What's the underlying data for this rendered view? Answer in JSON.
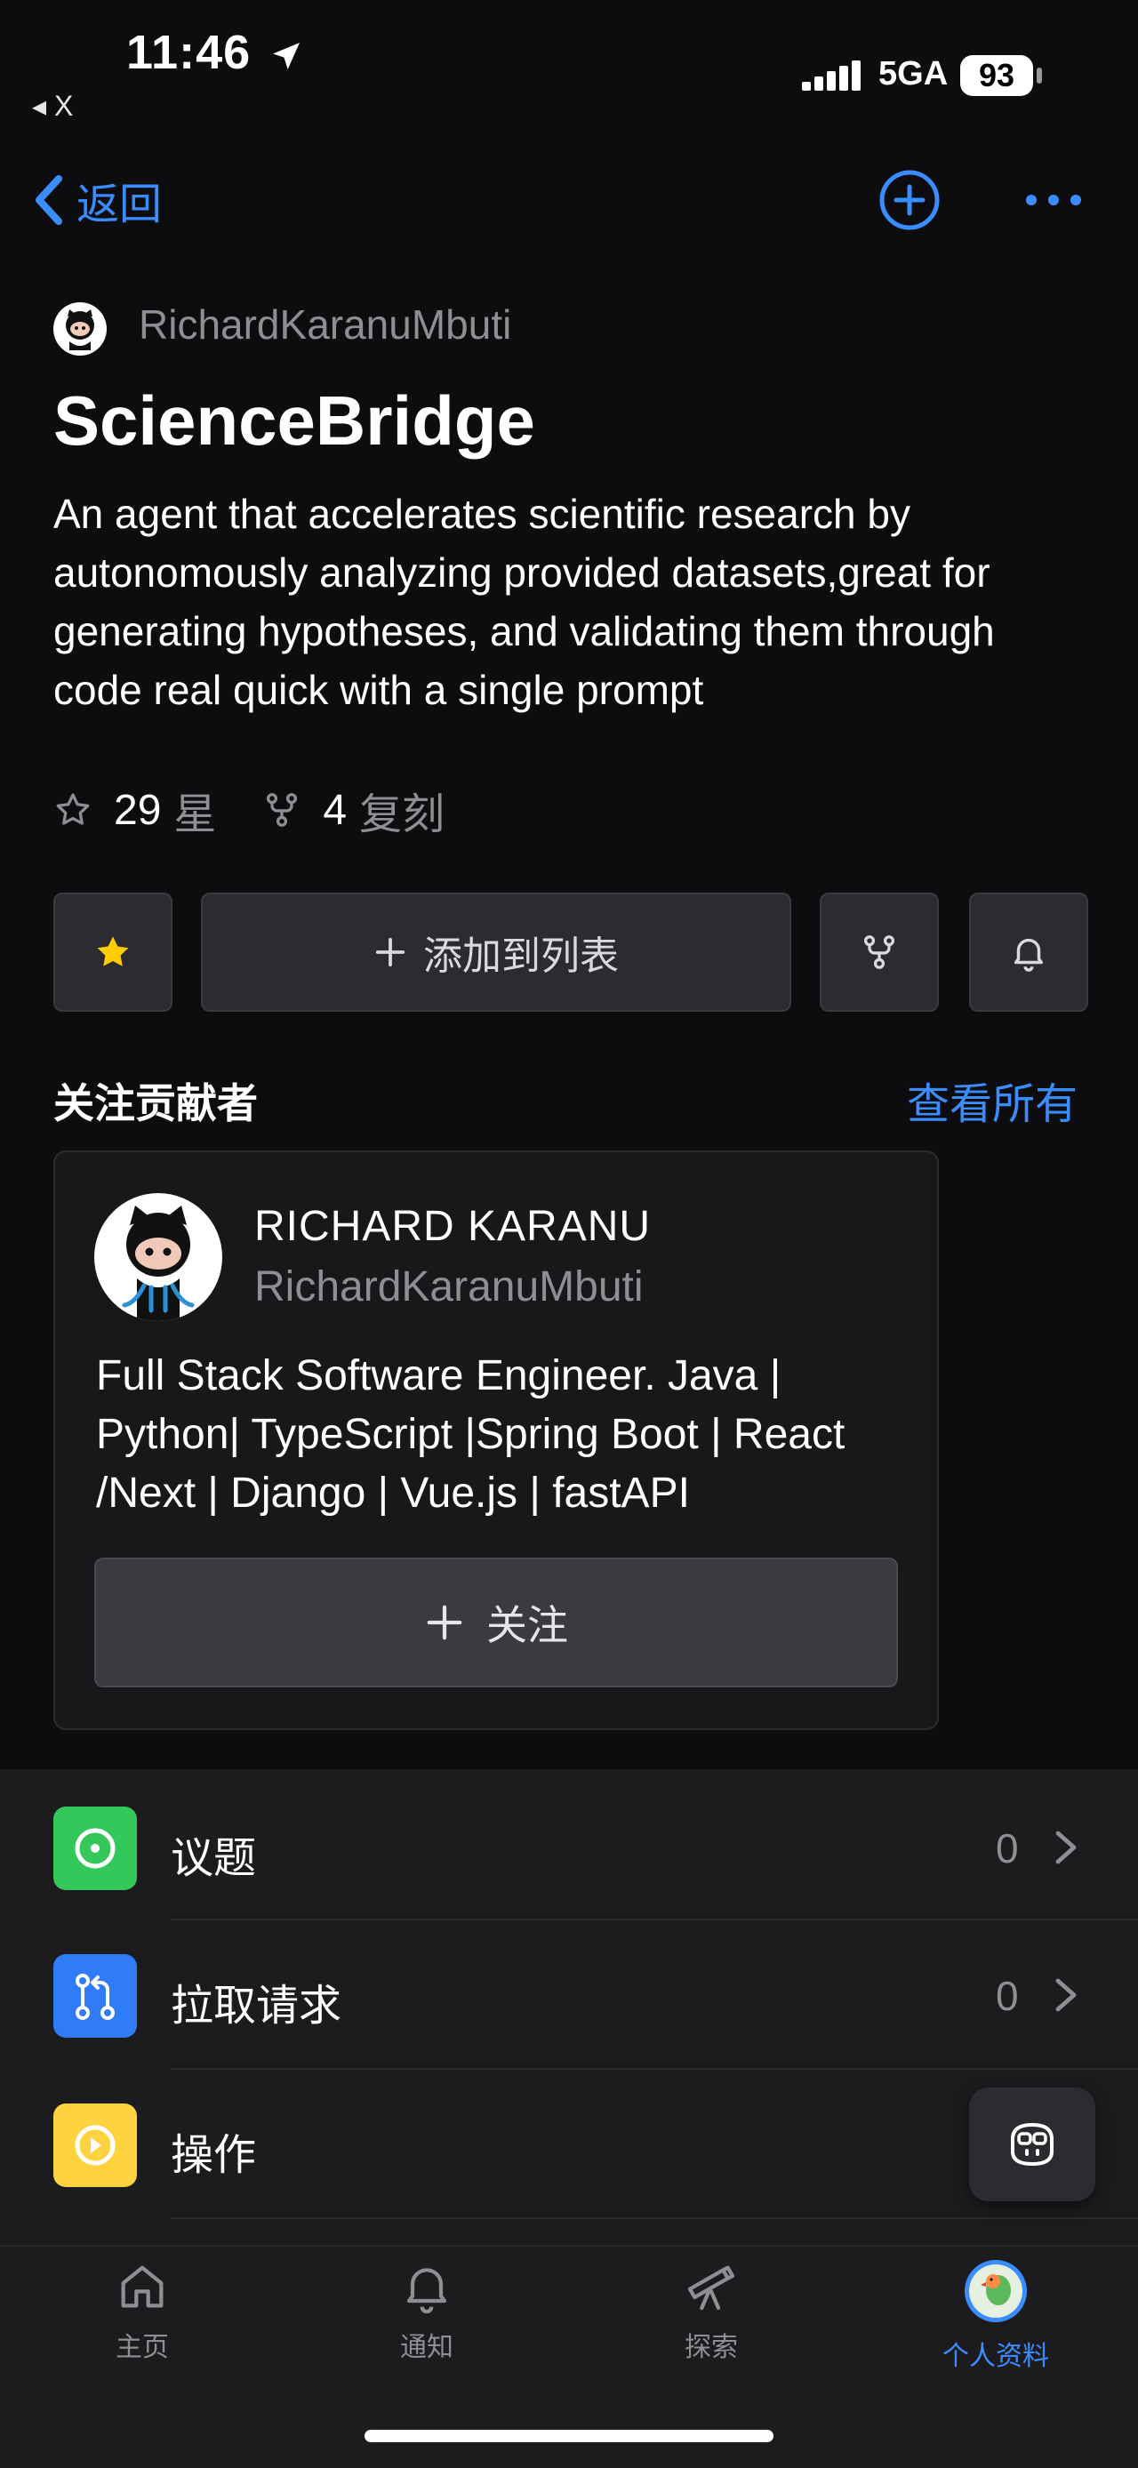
{
  "status_bar": {
    "time": "11:46",
    "back_app": "◂ X",
    "network": "5GA",
    "battery": "93"
  },
  "nav": {
    "back_label": "返回"
  },
  "repo": {
    "owner": "RichardKaranuMbuti",
    "name": "ScienceBridge",
    "description": "An agent that accelerates scientific research by autonomously analyzing provided datasets,great for generating hypotheses, and validating them through code real quick with a single prompt",
    "stars_count": "29",
    "stars_unit": "星",
    "forks_count": "4",
    "forks_unit": "复刻"
  },
  "actions": {
    "add_to_list": "添加到列表"
  },
  "contributors": {
    "section_title": "关注贡献者",
    "view_all": "查看所有",
    "card": {
      "name": "RICHARD KARANU",
      "login": "RichardKaranuMbuti",
      "bio": "Full Stack Software Engineer. Java | Python| TypeScript |Spring Boot | React /Next  | Django | Vue.js | fastAPI",
      "follow_label": "关注"
    }
  },
  "list": {
    "issues_label": "议题",
    "issues_count": "0",
    "pulls_label": "拉取请求",
    "pulls_count": "0",
    "actions_label": "操作",
    "colors": {
      "issues": "#34c759",
      "pulls": "#2f7cf6",
      "actions": "#ffd23f"
    }
  },
  "tabbar": {
    "home": "主页",
    "notifications": "通知",
    "explore": "探索",
    "profile": "个人资料",
    "active": "profile"
  }
}
